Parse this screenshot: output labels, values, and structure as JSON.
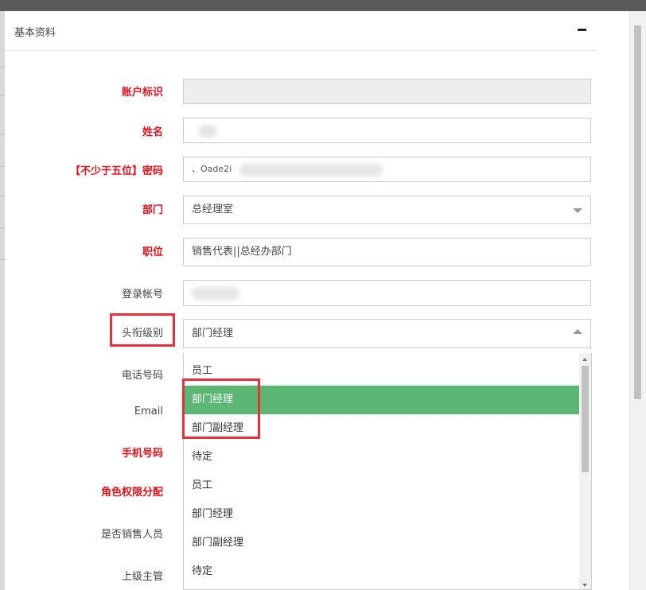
{
  "panel": {
    "title": "基本资料",
    "collapse_icon": "minus-icon"
  },
  "form": {
    "account_id": {
      "label": "账户标识",
      "value": ""
    },
    "name": {
      "label": "姓名"
    },
    "password": {
      "label": "【不少于五位】密码",
      "value": "、Oade2i"
    },
    "department": {
      "label": "部门",
      "value": "总经理室"
    },
    "position": {
      "label": "职位",
      "value": "销售代表||总经办部门"
    },
    "login": {
      "label": "登录帐号"
    },
    "title_level": {
      "label": "头衔级别",
      "value": "部门经理"
    },
    "phone": {
      "label": "电话号码"
    },
    "email": {
      "label": "Email"
    },
    "mobile": {
      "label": "手机号码"
    },
    "role": {
      "label": "角色权限分配"
    },
    "is_sales": {
      "label": "是否销售人员"
    },
    "supervisor": {
      "label": "上级主管"
    }
  },
  "dropdown": {
    "options": [
      "员工",
      "部门经理",
      "部门副经理",
      "待定",
      "员工",
      "部门经理",
      "部门副经理",
      "待定"
    ],
    "active_index": 1
  },
  "colors": {
    "required": "#e3111b",
    "active_option": "#5cb774",
    "highlight_box": "#e8313c"
  }
}
